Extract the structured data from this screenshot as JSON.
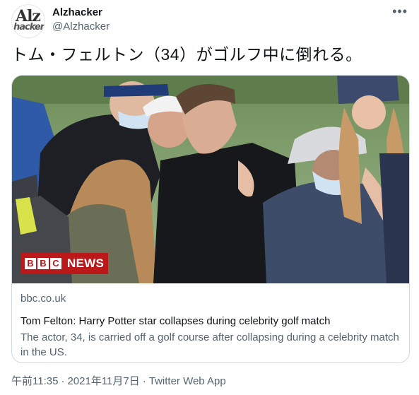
{
  "account": {
    "avatar_line1": "Alz",
    "avatar_line2": "hacker",
    "display_name": "Alzhacker",
    "handle": "@Alzhacker",
    "more_icon": "more-dots-icon"
  },
  "tweet": {
    "text": "トム・フェルトン（34）がゴルフ中に倒れる。"
  },
  "card": {
    "image_overlay": {
      "letters": [
        "B",
        "B",
        "C"
      ],
      "news": "NEWS"
    },
    "domain": "bbc.co.uk",
    "title": "Tom Felton: Harry Potter star collapses during celebrity golf match",
    "description": "The actor, 34, is carried off a golf course after collapsing during a celebrity match in the US."
  },
  "meta": {
    "time": "午前11:35",
    "separator": "·",
    "date": "2021年11月7日",
    "client": "Twitter Web App"
  },
  "colors": {
    "bbc_red": "#bb1919",
    "text_primary": "#0f1419",
    "text_secondary": "#536471",
    "border": "#cfd9de"
  }
}
